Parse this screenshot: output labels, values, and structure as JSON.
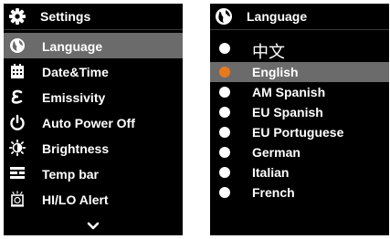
{
  "colors": {
    "screen_bg": "#000000",
    "selected_bg": "#6b6b6b",
    "text": "#ffffff",
    "active_dot": "#e87a1e"
  },
  "settings_screen": {
    "title": "Settings",
    "title_icon": "gear-icon",
    "items": [
      {
        "label": "Language",
        "icon": "globe-icon",
        "selected": true
      },
      {
        "label": "Date&Time",
        "icon": "calendar-icon",
        "selected": false
      },
      {
        "label": "Emissivity",
        "icon": "epsilon-icon",
        "selected": false
      },
      {
        "label": "Auto Power Off",
        "icon": "power-icon",
        "selected": false
      },
      {
        "label": "Brightness",
        "icon": "brightness-icon",
        "selected": false
      },
      {
        "label": "Temp bar",
        "icon": "temp-bar-icon",
        "selected": false
      },
      {
        "label": "HI/LO Alert",
        "icon": "alarm-icon",
        "selected": false
      }
    ],
    "more_icon": "chevron-down-icon"
  },
  "language_screen": {
    "title": "Language",
    "title_icon": "globe-icon",
    "options": [
      {
        "label": "中文",
        "selected": false
      },
      {
        "label": "English",
        "selected": true
      },
      {
        "label": "AM Spanish",
        "selected": false
      },
      {
        "label": "EU Spanish",
        "selected": false
      },
      {
        "label": "EU Portuguese",
        "selected": false
      },
      {
        "label": "German",
        "selected": false
      },
      {
        "label": "Italian",
        "selected": false
      },
      {
        "label": "French",
        "selected": false
      }
    ]
  }
}
